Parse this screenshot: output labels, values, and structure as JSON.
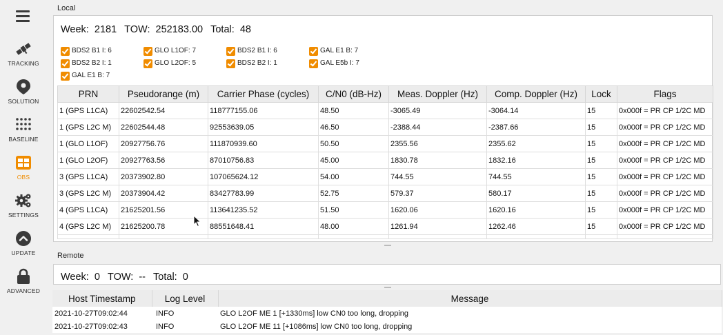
{
  "sidebar": {
    "items": [
      {
        "label": "TRACKING",
        "icon": "satellite-icon",
        "active": false
      },
      {
        "label": "SOLUTION",
        "icon": "map-pin-icon",
        "active": false
      },
      {
        "label": "BASELINE",
        "icon": "dots-grid-icon",
        "active": false
      },
      {
        "label": "OBS",
        "icon": "grid-icon",
        "active": true
      },
      {
        "label": "SETTINGS",
        "icon": "gears-icon",
        "active": false
      },
      {
        "label": "UPDATE",
        "icon": "chevron-up-circle-icon",
        "active": false
      },
      {
        "label": "ADVANCED",
        "icon": "lock-icon",
        "active": false
      }
    ],
    "accent_color": "#f08c00"
  },
  "local": {
    "title": "Local",
    "week_label": "Week:",
    "week": "2181",
    "tow_label": "TOW:",
    "tow": "252183.00",
    "total_label": "Total:",
    "total": "48",
    "filters": [
      "BDS2 B1 I: 6",
      "GLO L1OF: 7",
      "BDS2 B1 I: 6",
      "GAL E1 B: 7",
      "BDS2 B2 I: 1",
      "GLO L2OF: 5",
      "BDS2 B2 I: 1",
      "GAL E5b I: 7",
      "GAL E1 B: 7"
    ],
    "columns": [
      "PRN",
      "Pseudorange (m)",
      "Carrier Phase (cycles)",
      "C/N0 (dB-Hz)",
      "Meas. Doppler (Hz)",
      "Comp. Doppler (Hz)",
      "Lock",
      "Flags"
    ],
    "rows": [
      [
        "1 (GPS L1CA)",
        "22602542.54",
        "118777155.06",
        "48.50",
        "-3065.49",
        "-3064.14",
        "15",
        "0x000f = PR CP 1/2C MD"
      ],
      [
        "1 (GPS L2C M)",
        "22602544.48",
        "92553639.05",
        "46.50",
        "-2388.44",
        "-2387.66",
        "15",
        "0x000f = PR CP 1/2C MD"
      ],
      [
        "1 (GLO L1OF)",
        "20927756.76",
        "111870939.60",
        "50.50",
        "2355.56",
        "2355.62",
        "15",
        "0x000f = PR CP 1/2C MD"
      ],
      [
        "1 (GLO L2OF)",
        "20927763.56",
        "87010756.83",
        "45.00",
        "1830.78",
        "1832.16",
        "15",
        "0x000f = PR CP 1/2C MD"
      ],
      [
        "3 (GPS L1CA)",
        "20373902.80",
        "107065624.12",
        "54.00",
        "744.55",
        "744.55",
        "15",
        "0x000f = PR CP 1/2C MD"
      ],
      [
        "3 (GPS L2C M)",
        "20373904.42",
        "83427783.99",
        "52.75",
        "579.37",
        "580.17",
        "15",
        "0x000f = PR CP 1/2C MD"
      ],
      [
        "4 (GPS L1CA)",
        "21625201.56",
        "113641235.52",
        "51.50",
        "1620.06",
        "1620.16",
        "15",
        "0x000f = PR CP 1/2C MD"
      ],
      [
        "4 (GPS L2C M)",
        "21625200.78",
        "88551648.41",
        "48.00",
        "1261.94",
        "1262.46",
        "15",
        "0x000f = PR CP 1/2C MD"
      ]
    ]
  },
  "remote": {
    "title": "Remote",
    "week_label": "Week:",
    "week": "0",
    "tow_label": "TOW:",
    "tow": "--",
    "total_label": "Total:",
    "total": "0"
  },
  "log": {
    "columns": [
      "Host Timestamp",
      "Log Level",
      "Message"
    ],
    "rows": [
      [
        "2021-10-27T09:02:44",
        "INFO",
        "GLO L2OF ME 1 [+1330ms] low CN0 too long, dropping"
      ],
      [
        "2021-10-27T09:02:43",
        "INFO",
        "GLO L2OF ME 11 [+1086ms] low CN0 too long, dropping"
      ]
    ]
  }
}
